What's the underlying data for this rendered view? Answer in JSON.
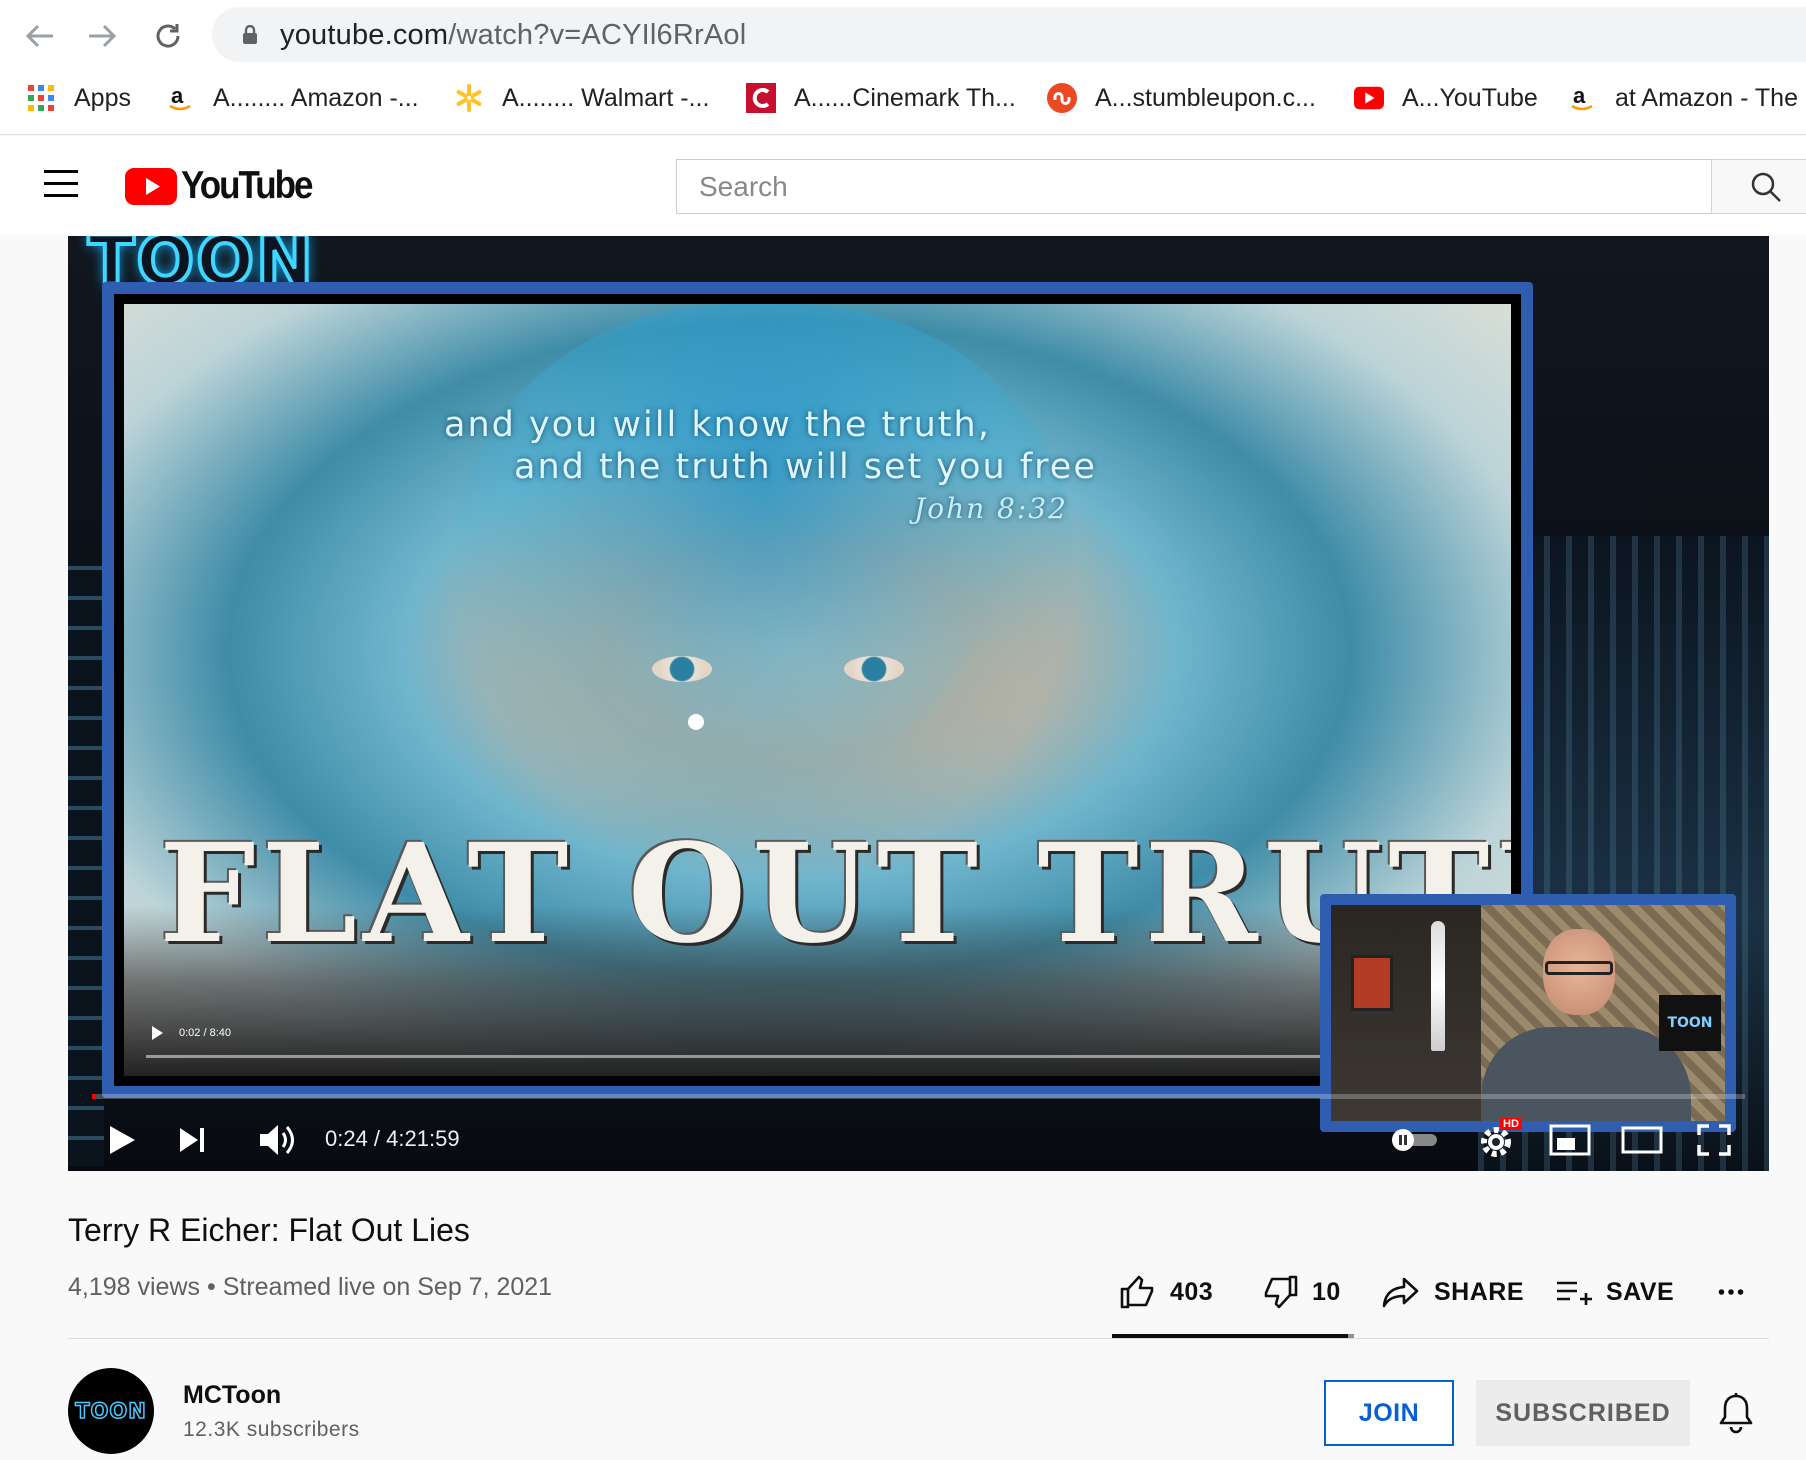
{
  "browser": {
    "url_host": "youtube.com",
    "url_path": "/watch?v=ACYIl6RrAol",
    "bookmarks": [
      {
        "label": "Apps",
        "icon": "apps-grid-icon"
      },
      {
        "label": "A........ Amazon -...",
        "icon": "amazon-icon"
      },
      {
        "label": "A........ Walmart -...",
        "icon": "walmart-icon"
      },
      {
        "label": "A......Cinemark Th...",
        "icon": "cinemark-icon"
      },
      {
        "label": "A...stumbleupon.c...",
        "icon": "stumbleupon-icon"
      },
      {
        "label": "A...YouTube",
        "icon": "youtube-icon"
      },
      {
        "label": "at Amazon - The",
        "icon": "amazon-icon"
      }
    ]
  },
  "header": {
    "logo_text": "YouTube",
    "search_placeholder": "Search"
  },
  "player": {
    "overlay_logo": "TOON",
    "quote_line1": "and you will know the truth,",
    "quote_line2": "and the truth will set you free",
    "quote_ref": "John 8:32",
    "big_title": "FLAT OUT TRUTH",
    "inner_time": "0:02 / 8:40",
    "cam_tag": "TOON",
    "time": "0:24 / 4:21:59",
    "progress_fraction": 0.0016,
    "hd_badge": "HD"
  },
  "video": {
    "title": "Terry R Eicher: Flat Out Lies",
    "views": "4,198 views",
    "separator": "•",
    "streamed": "Streamed live on Sep 7, 2021",
    "likes": "403",
    "dislikes": "10",
    "share_label": "SHARE",
    "save_label": "SAVE",
    "like_fraction": 0.976
  },
  "channel": {
    "avatar_text": "TOON",
    "name": "MCToon",
    "subscribers": "12.3K subscribers",
    "join_label": "JOIN",
    "subscribed_label": "SUBSCRIBED"
  },
  "colors": {
    "youtube_red": "#ff0000",
    "join_blue": "#065fd4",
    "frame_blue": "#2f5db0"
  }
}
